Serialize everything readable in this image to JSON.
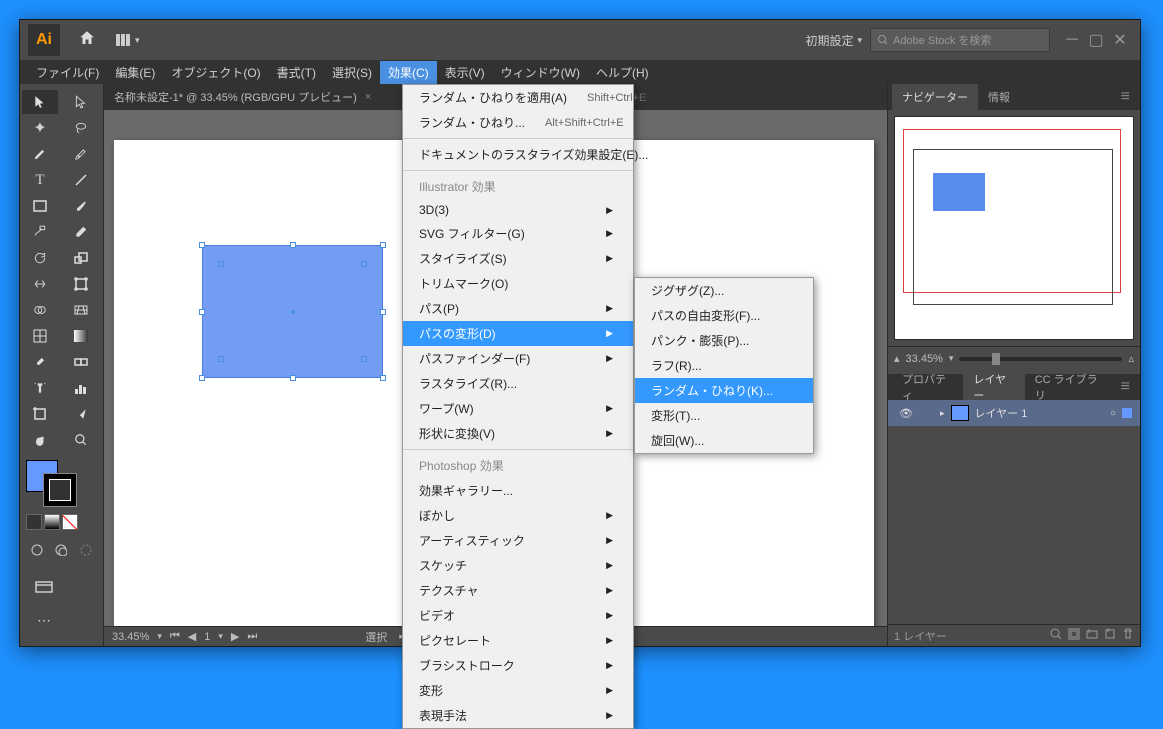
{
  "app": {
    "logo": "Ai"
  },
  "title_bar": {
    "workspace": "初期設定",
    "search_placeholder": "Adobe Stock を検索"
  },
  "menu": {
    "items": [
      "ファイル(F)",
      "編集(E)",
      "オブジェクト(O)",
      "書式(T)",
      "選択(S)",
      "効果(C)",
      "表示(V)",
      "ウィンドウ(W)",
      "ヘルプ(H)"
    ],
    "active_index": 5
  },
  "document": {
    "tab": "名称未設定-1* @ 33.45% (RGB/GPU プレビュー)",
    "zoom": "33.45%",
    "page": "1",
    "status": "選択"
  },
  "effect_menu": {
    "apply": "ランダム・ひねりを適用(A)",
    "apply_shortcut": "Shift+Ctrl+E",
    "last": "ランダム・ひねり...",
    "last_shortcut": "Alt+Shift+Ctrl+E",
    "raster_settings": "ドキュメントのラスタライズ効果設定(E)...",
    "section1": "Illustrator 効果",
    "items1": [
      "3D(3)",
      "SVG フィルター(G)",
      "スタイライズ(S)",
      "トリムマーク(O)",
      "パス(P)",
      "パスの変形(D)",
      "パスファインダー(F)",
      "ラスタライズ(R)...",
      "ワープ(W)",
      "形状に変換(V)"
    ],
    "section2": "Photoshop 効果",
    "items2": [
      "効果ギャラリー...",
      "ぼかし",
      "アーティスティック",
      "スケッチ",
      "テクスチャ",
      "ビデオ",
      "ピクセレート",
      "ブラシストローク",
      "変形",
      "表現手法"
    ],
    "highlighted": "パスの変形(D)"
  },
  "distort_submenu": {
    "items": [
      "ジグザグ(Z)...",
      "パスの自由変形(F)...",
      "パンク・膨張(P)...",
      "ラフ(R)...",
      "ランダム・ひねり(K)...",
      "変形(T)...",
      "旋回(W)..."
    ],
    "highlighted_index": 4
  },
  "right": {
    "navigator_tab": "ナビゲーター",
    "info_tab": "情報",
    "zoom": "33.45%",
    "property_tab": "プロパティ",
    "layers_tab": "レイヤー",
    "cc_tab": "CC ライブラリ",
    "layer_name": "レイヤー 1",
    "layers_count": "1 レイヤー"
  }
}
